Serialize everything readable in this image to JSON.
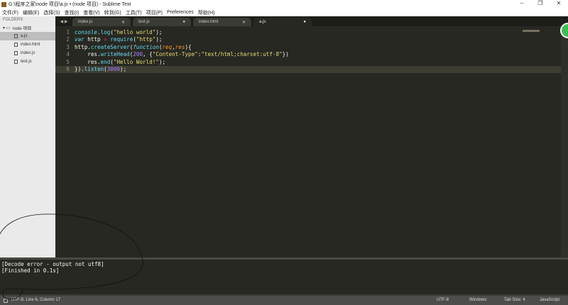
{
  "window": {
    "title": "G:\\程序之家\\node 项目\\a.js • (node 项目) - Sublime Text",
    "minimize": "–",
    "maximize": "❐",
    "close": "✕"
  },
  "menu": [
    "文件(F)",
    "编辑(E)",
    "选择(S)",
    "查找(I)",
    "查看(V)",
    "转到(G)",
    "工具(T)",
    "项目(P)",
    "Preferences",
    "帮助(H)"
  ],
  "sidebar": {
    "header": "FOLDERS",
    "folder": "node 项目",
    "files": [
      "a.js",
      "index.html",
      "index.js",
      "test.js"
    ]
  },
  "tabs": [
    {
      "label": "index.js",
      "icon": "✕"
    },
    {
      "label": "test.js",
      "icon": "●"
    },
    {
      "label": "index.html",
      "icon": "✕"
    },
    {
      "label": "a.js",
      "icon": "●"
    }
  ],
  "nav": "◀ ▶",
  "code": {
    "line_numbers": [
      "1",
      "2",
      "3",
      "4",
      "5",
      "6"
    ]
  },
  "output": [
    "[Decode error - output not utf8]",
    "[Finished in 0.1s]"
  ],
  "status": {
    "left": "UTF-8, Line 6, Column 17",
    "encoding": "UTF-8",
    "line_endings": "Windows",
    "tab_size": "Tab Size: 4",
    "syntax": "JavaScript"
  }
}
